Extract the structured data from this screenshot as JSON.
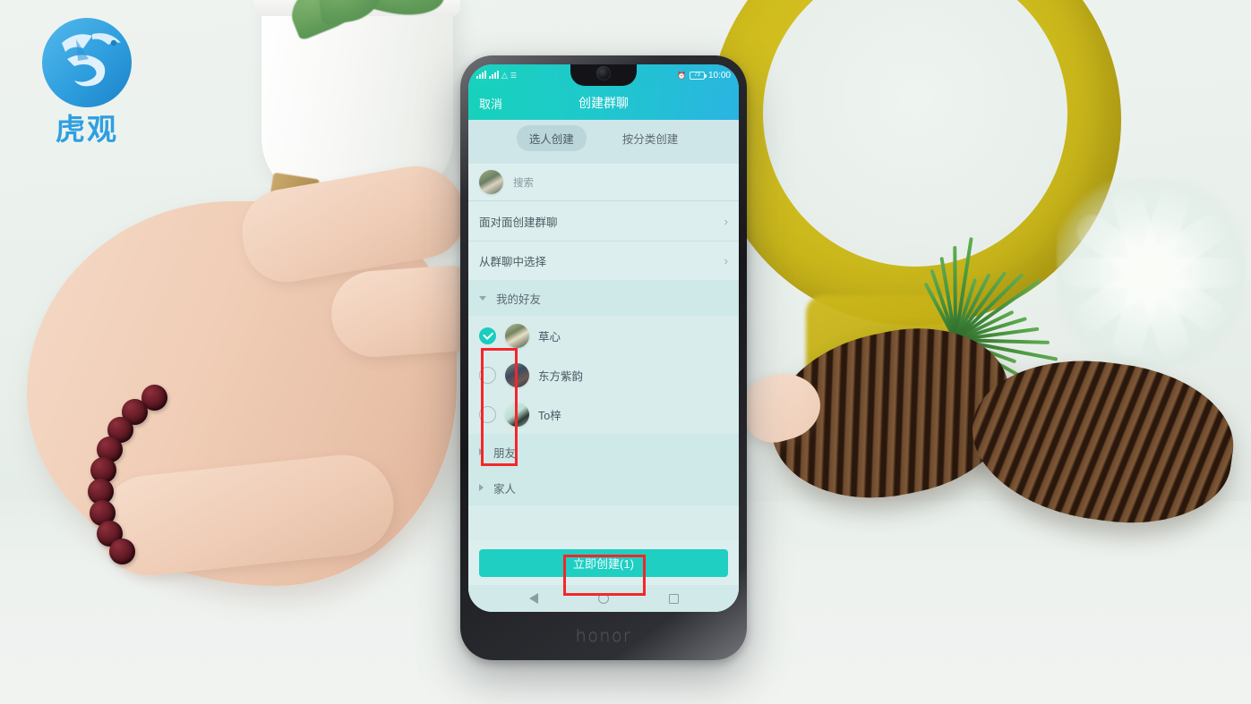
{
  "watermark": {
    "brand_text": "虎观",
    "logo_name": "tiger-circle-logo",
    "color": "#2f9fe0"
  },
  "device": {
    "brand": "honor",
    "model_label": "honor",
    "nav": {
      "back": "back-icon",
      "home": "home-icon",
      "recents": "recents-icon"
    }
  },
  "status_bar": {
    "signal": "signal-bars-icon",
    "wifi": "wifi-icon",
    "vibrate": "vibrate-icon",
    "alarm": "alarm-icon",
    "battery_level": "73",
    "time": "10:00"
  },
  "header": {
    "cancel_label": "取消",
    "title": "创建群聊",
    "gradient_start": "#16d2bb",
    "gradient_end": "#2ab4e2"
  },
  "tabs": [
    {
      "label": "选人创建",
      "active": true
    },
    {
      "label": "按分类创建",
      "active": false
    }
  ],
  "search": {
    "placeholder": "搜索",
    "avatar": "user-avatar"
  },
  "actions": [
    {
      "label": "面对面创建群聊",
      "chevron": "chevron-right-icon"
    },
    {
      "label": "从群聊中选择",
      "chevron": "chevron-right-icon"
    }
  ],
  "groups": [
    {
      "label": "我的好友",
      "expanded": true,
      "contacts": [
        {
          "name": "草心",
          "checked": true
        },
        {
          "name": "东方紫韵",
          "checked": false
        },
        {
          "name": "To梓",
          "checked": false
        }
      ]
    },
    {
      "label": "朋友",
      "expanded": false,
      "contacts": []
    },
    {
      "label": "家人",
      "expanded": false,
      "contacts": []
    }
  ],
  "create_button": {
    "label": "立即创建(1)",
    "selected_count": "1",
    "color": "#1fcfc2"
  },
  "annotations": [
    {
      "name": "checkbox-column-highlight",
      "color": "#f5262b"
    },
    {
      "name": "create-button-highlight",
      "color": "#f5262b"
    }
  ],
  "scene": {
    "objects": [
      "hand",
      "beaded-bracelet",
      "white-plant-pot",
      "yellow-ring",
      "pinecone",
      "pine-needles",
      "glitter-star"
    ]
  }
}
